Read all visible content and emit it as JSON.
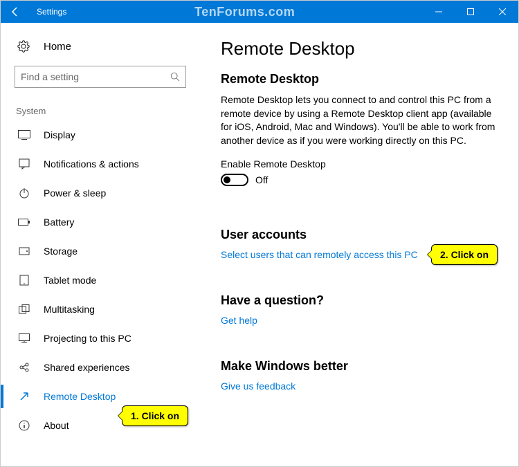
{
  "titlebar": {
    "title": "Settings",
    "watermark": "TenForums.com"
  },
  "sidebar": {
    "home": "Home",
    "search_placeholder": "Find a setting",
    "section": "System",
    "items": [
      {
        "label": "Display"
      },
      {
        "label": "Notifications & actions"
      },
      {
        "label": "Power & sleep"
      },
      {
        "label": "Battery"
      },
      {
        "label": "Storage"
      },
      {
        "label": "Tablet mode"
      },
      {
        "label": "Multitasking"
      },
      {
        "label": "Projecting to this PC"
      },
      {
        "label": "Shared experiences"
      },
      {
        "label": "Remote Desktop"
      },
      {
        "label": "About"
      }
    ]
  },
  "main": {
    "title": "Remote Desktop",
    "subtitle": "Remote Desktop",
    "desc": "Remote Desktop lets you connect to and control this PC from a remote device by using a Remote Desktop client app (available for iOS, Android, Mac and Windows). You'll be able to work from another device as if you were working directly on this PC.",
    "enable_label": "Enable Remote Desktop",
    "toggle_state": "Off",
    "user_accounts_heading": "User accounts",
    "user_accounts_link": "Select users that can remotely access this PC",
    "question_heading": "Have a question?",
    "get_help": "Get help",
    "better_heading": "Make Windows better",
    "feedback": "Give us feedback"
  },
  "callouts": {
    "one": "1. Click on",
    "two": "2. Click on"
  }
}
